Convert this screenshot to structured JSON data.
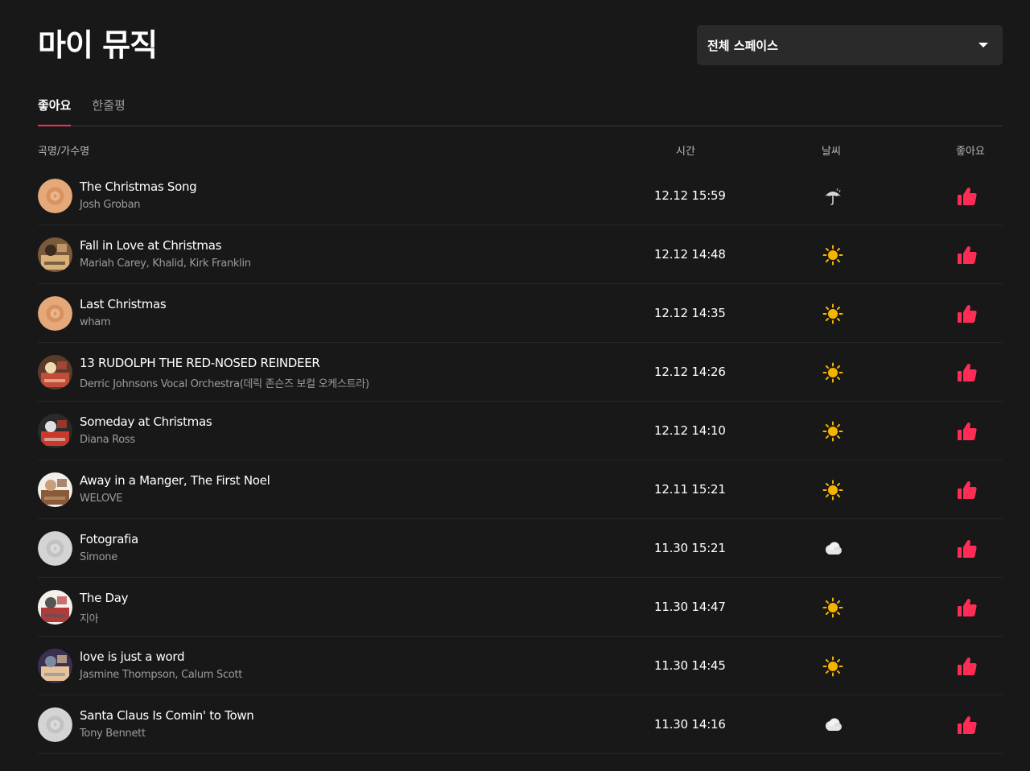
{
  "header": {
    "title": "마이 뮤직",
    "space_select": "전체 스페이스"
  },
  "tabs": [
    {
      "label": "좋아요",
      "active": true
    },
    {
      "label": "한줄평",
      "active": false
    }
  ],
  "columns": {
    "song": "곡명/가수명",
    "time": "시간",
    "weather": "날씨",
    "like": "좋아요"
  },
  "colors": {
    "accent": "#ff2d55",
    "background": "#181818",
    "sun": "#f5b400"
  },
  "rows": [
    {
      "title": "The Christmas Song",
      "artist": "Josh Groban",
      "time": "12.12 15:59",
      "weather": "umbrella-rain-icon",
      "cover": "default-orange-disc"
    },
    {
      "title": "Fall in Love at Christmas",
      "artist": "Mariah Carey, Khalid, Kirk Franklin",
      "time": "12.12 14:48",
      "weather": "sun-icon",
      "cover": "album-art"
    },
    {
      "title": "Last Christmas",
      "artist": "wham",
      "time": "12.12 14:35",
      "weather": "sun-icon",
      "cover": "default-orange-disc"
    },
    {
      "title": "13 RUDOLPH THE RED-NOSED REINDEER",
      "artist": "Derric Johnsons Vocal Orchestra(데릭 존슨즈 보컬 오케스트라)",
      "time": "12.12 14:26",
      "weather": "sun-icon",
      "cover": "album-art"
    },
    {
      "title": "Someday at Christmas",
      "artist": "Diana Ross",
      "time": "12.12 14:10",
      "weather": "sun-icon",
      "cover": "album-art"
    },
    {
      "title": "Away in a Manger, The First Noel",
      "artist": "WELOVE",
      "time": "12.11 15:21",
      "weather": "sun-icon",
      "cover": "album-art"
    },
    {
      "title": "Fotografia",
      "artist": "Simone",
      "time": "11.30 15:21",
      "weather": "cloud-icon",
      "cover": "default-gray-disc"
    },
    {
      "title": "The Day",
      "artist": "지아",
      "time": "11.30 14:47",
      "weather": "sun-icon",
      "cover": "album-art"
    },
    {
      "title": "love is just a word",
      "artist": "Jasmine Thompson, Calum Scott",
      "time": "11.30 14:45",
      "weather": "sun-icon",
      "cover": "album-art"
    },
    {
      "title": "Santa Claus Is Comin' to Town",
      "artist": "Tony Bennett",
      "time": "11.30 14:16",
      "weather": "cloud-icon",
      "cover": "default-gray-disc"
    }
  ]
}
